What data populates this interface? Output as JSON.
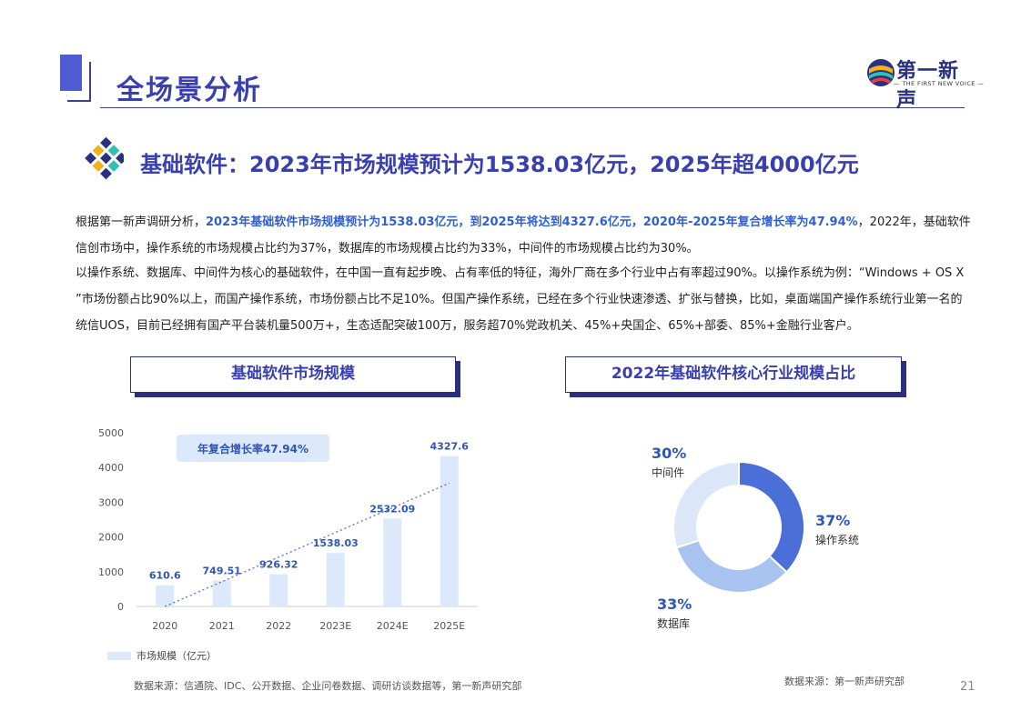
{
  "header": {
    "title": "全场景分析"
  },
  "logo": {
    "name_cn": "第一新声",
    "name_en": "— THE FIRST NEW VOICE —"
  },
  "subtitle": "基础软件：2023年市场规模预计为1538.03亿元，2025年超4000亿元",
  "paragraph1": {
    "t1": "根据第一新声调研分析，",
    "h1": "2023年基础软件市场规模预计为1538.03亿元，到2025年将达到4327.6亿元，",
    "h2": "2020年-2025年复合增长率为47.94%",
    "t2": "，2022年，基础软件信创市场中，操作系统的市场规模占比约为37%，数据库的市场规模占比约为33%，中间件的市场规模占比约为30%。"
  },
  "paragraph2": "以操作系统、数据库、中间件为核心的基础软件，在中国一直有起步晚、占有率低的特征，海外厂商在多个行业中占有率超过90%。以操作系统为例：“Windows + OS X ”市场份额占比90%以上，而国产操作系统，市场份额占比不足10%。但国产操作系统，已经在多个行业快速渗透、扩张与替换，比如，桌面端国产操作系统行业第一名的统信UOS，目前已经拥有国产平台装机量500万+，生态适配突破100万，服务超70%党政机关、45%+央国企、65%+部委、85%+金融行业客户。",
  "sections": {
    "left_title": "基础软件市场规模",
    "right_title": "2022年基础软件核心行业规模占比"
  },
  "chart_data": [
    {
      "type": "bar",
      "categories": [
        "2020",
        "2021",
        "2022",
        "2023E",
        "2024E",
        "2025E"
      ],
      "series": [
        {
          "name": "市场规模（亿元）",
          "values": [
            610.6,
            749.51,
            926.32,
            1538.03,
            2532.09,
            4327.6
          ]
        }
      ],
      "value_labels": [
        "610.6",
        "749.51",
        "926.32",
        "1538.03",
        "2532.09",
        "4327.6"
      ],
      "y_ticks": [
        "0",
        "1000",
        "2000",
        "3000",
        "4000",
        "5000"
      ],
      "ylim": [
        0,
        5000
      ],
      "annotation": "年复合增长率47.94%",
      "trendline": true,
      "legend": "bottom-left",
      "bar_color": "#dce9fb",
      "label_color": "#2f55b8"
    },
    {
      "type": "pie",
      "donut": true,
      "slices": [
        {
          "label": "操作系统",
          "value": 37,
          "pct": "37%",
          "color": "#4a6fd8"
        },
        {
          "label": "数据库",
          "value": 33,
          "pct": "33%",
          "color": "#a9c3f1"
        },
        {
          "label": "中间件",
          "value": 30,
          "pct": "30%",
          "color": "#dbe6f9"
        }
      ]
    }
  ],
  "footer": {
    "source_left": "数据来源：信通院、IDC、公开数据、企业问卷数据、调研访谈数据等，第一新声研究部",
    "source_right": "数据来源：第一新声研究部",
    "page": "21"
  }
}
